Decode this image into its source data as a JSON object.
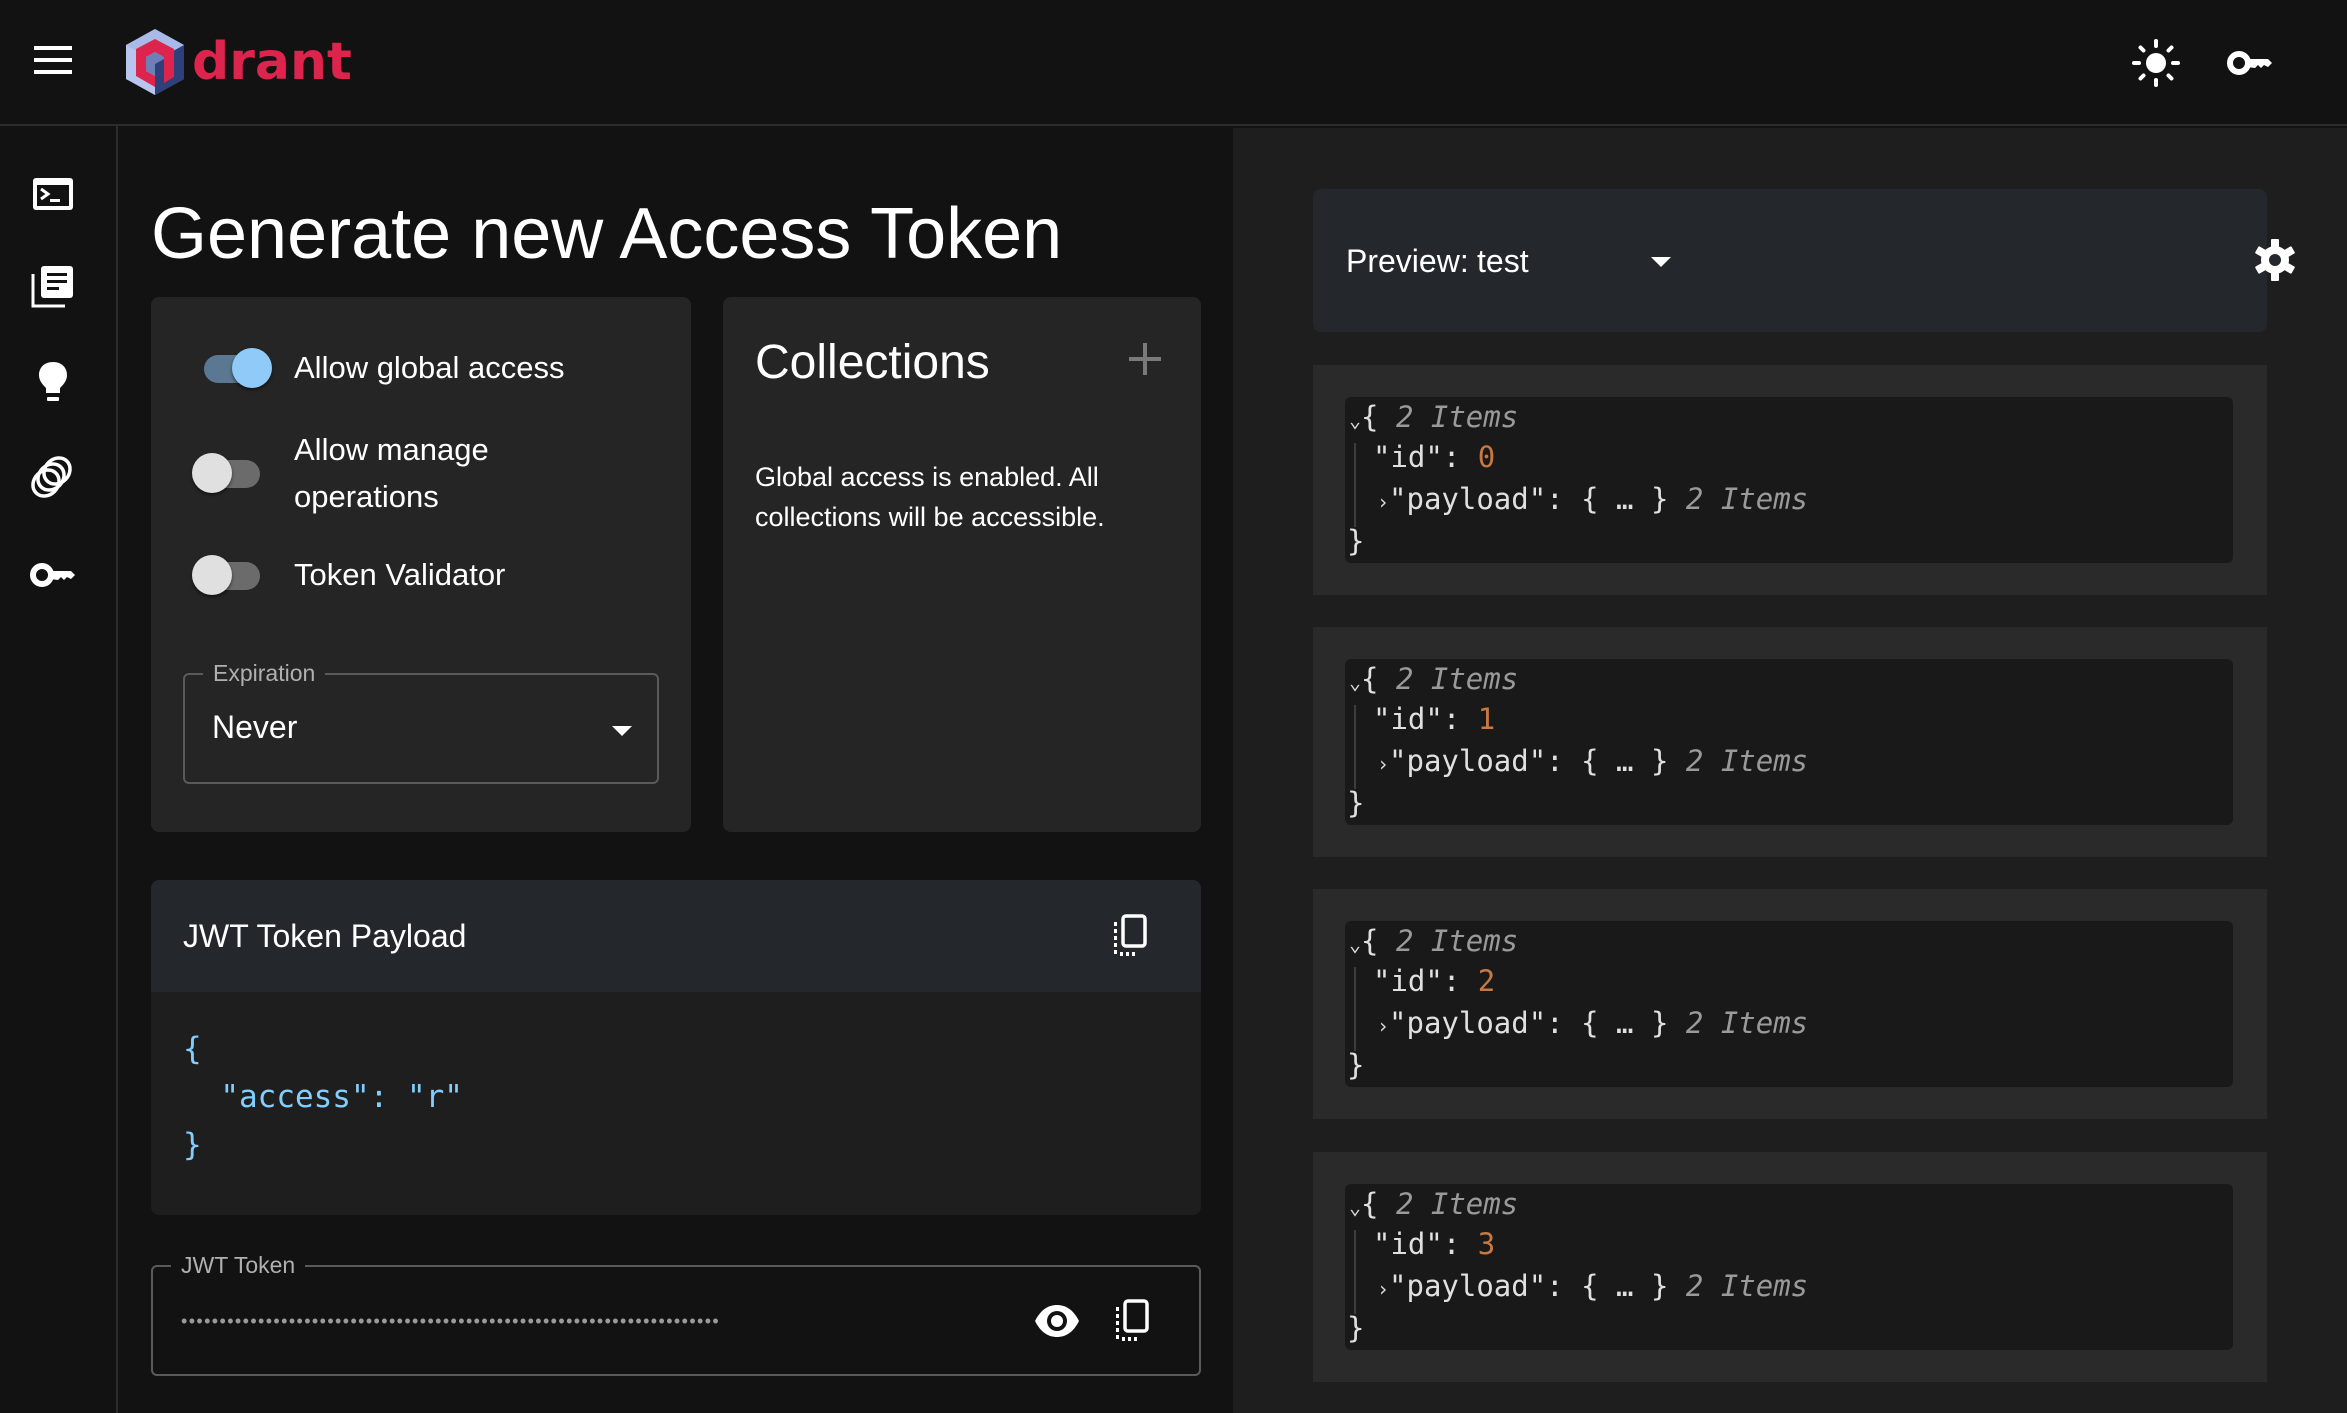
{
  "header": {
    "logo_text": "drant",
    "theme_toggle_icon": "sun-icon",
    "api_key_icon": "key-icon"
  },
  "sidebar": {
    "items": [
      {
        "name": "console",
        "icon": "terminal-icon"
      },
      {
        "name": "collections",
        "icon": "library-books-icon"
      },
      {
        "name": "tutorial",
        "icon": "lightbulb-icon"
      },
      {
        "name": "datasets",
        "icon": "rings-icon"
      },
      {
        "name": "access-tokens",
        "icon": "key-icon"
      }
    ]
  },
  "page": {
    "title": "Generate new Access Token"
  },
  "settings": {
    "toggles": [
      {
        "label": "Allow global access",
        "checked": true
      },
      {
        "label": "Allow manage operations",
        "checked": false
      },
      {
        "label": "Token Validator",
        "checked": false
      }
    ],
    "expiration": {
      "label": "Expiration",
      "value": "Never"
    }
  },
  "collections": {
    "title": "Collections",
    "message": "Global access is enabled. All collections will be accessible."
  },
  "payload": {
    "title": "JWT Token Payload",
    "code_open": "{",
    "code_line": "  \"access\": \"r\"",
    "code_close": "}"
  },
  "token": {
    "label": "JWT Token",
    "masked_value": "••••••••••••••••••••••••••••••••••••••••••••••••••••••••••••••••••••••"
  },
  "preview": {
    "label": "Preview:",
    "collection": "test",
    "points": [
      {
        "items_label": "2 Items",
        "id_key": "\"id\":",
        "id": "0",
        "payload_key": "\"payload\":",
        "payload_collapsed": "{ … }",
        "payload_items": "2 Items"
      },
      {
        "items_label": "2 Items",
        "id_key": "\"id\":",
        "id": "1",
        "payload_key": "\"payload\":",
        "payload_collapsed": "{ … }",
        "payload_items": "2 Items"
      },
      {
        "items_label": "2 Items",
        "id_key": "\"id\":",
        "id": "2",
        "payload_key": "\"payload\":",
        "payload_collapsed": "{ … }",
        "payload_items": "2 Items"
      },
      {
        "items_label": "2 Items",
        "id_key": "\"id\":",
        "id": "3",
        "payload_key": "\"payload\":",
        "payload_collapsed": "{ … }",
        "payload_items": "2 Items"
      }
    ]
  },
  "colors": {
    "brand": "#dc244c",
    "switch_on": "#90caf9",
    "code_blue": "#82cfff",
    "number_orange": "#c87941"
  }
}
